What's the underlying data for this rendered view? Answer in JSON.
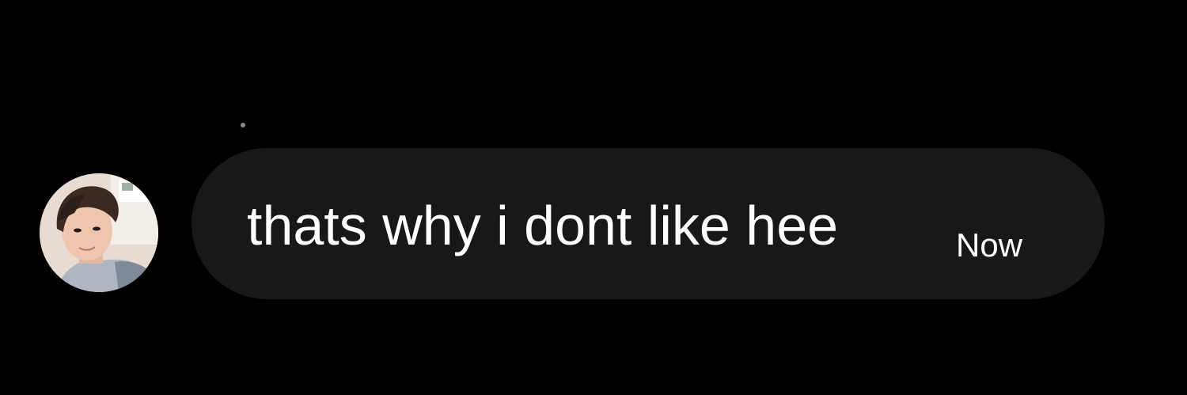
{
  "message": {
    "text": "thats why i dont like hee",
    "timestamp": "Now"
  },
  "avatar": {
    "icon": "profile-photo-icon"
  },
  "colors": {
    "background": "#000000",
    "bubble": "#18181b",
    "text": "#ffffff"
  }
}
